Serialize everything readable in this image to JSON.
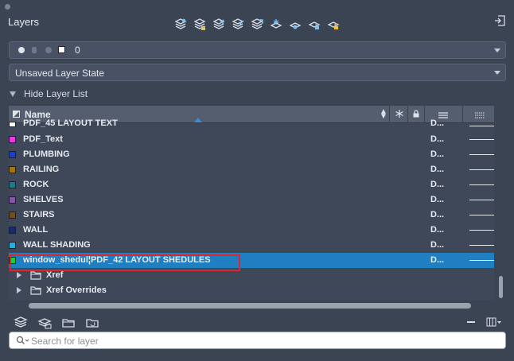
{
  "panel": {
    "title": "Layers"
  },
  "current_layer": {
    "name": "0",
    "color": "#ffffff"
  },
  "layer_state": {
    "value": "Unsaved Layer State"
  },
  "hide_list": {
    "label": "Hide Layer List"
  },
  "list": {
    "header": {
      "name": "Name"
    },
    "rows": [
      {
        "name": "PDF_45 LAYOUT TEXT",
        "color": "#ffffff",
        "desc": "D...",
        "partial": true
      },
      {
        "name": "PDF_Text",
        "color": "#e040e0",
        "desc": "D..."
      },
      {
        "name": "PLUMBING",
        "color": "#1a3fd0",
        "desc": "D..."
      },
      {
        "name": "RAILING",
        "color": "#a07810",
        "desc": "D..."
      },
      {
        "name": "ROCK",
        "color": "#1a7a90",
        "desc": "D..."
      },
      {
        "name": "SHELVES",
        "color": "#8855aa",
        "desc": "D..."
      },
      {
        "name": "STAIRS",
        "color": "#7a4a1a",
        "desc": "D..."
      },
      {
        "name": "WALL",
        "color": "#1a2a6a",
        "desc": "D..."
      },
      {
        "name": "WALL SHADING",
        "color": "#20b0e0",
        "desc": "D..."
      },
      {
        "name": "window_shedul¦PDF_42 LAYOUT SHEDULES",
        "color": "#22cc33",
        "desc": "D...",
        "selected": true
      }
    ],
    "folders": [
      {
        "name": "Xref"
      },
      {
        "name": "Xref Overrides"
      }
    ]
  },
  "search": {
    "placeholder": "Search for layer"
  },
  "icons": {
    "toolbar": [
      "new-layer-icon",
      "new-layer-vp-frozen-icon",
      "delete-layer-icon",
      "set-current-icon",
      "match-layer-icon",
      "freeze-icon",
      "isolate-icon",
      "lock-icon",
      "unlock-icon"
    ],
    "bottom": [
      "new-group-filter-icon",
      "new-property-filter-icon",
      "folder-icon",
      "folder-refresh-icon"
    ]
  }
}
